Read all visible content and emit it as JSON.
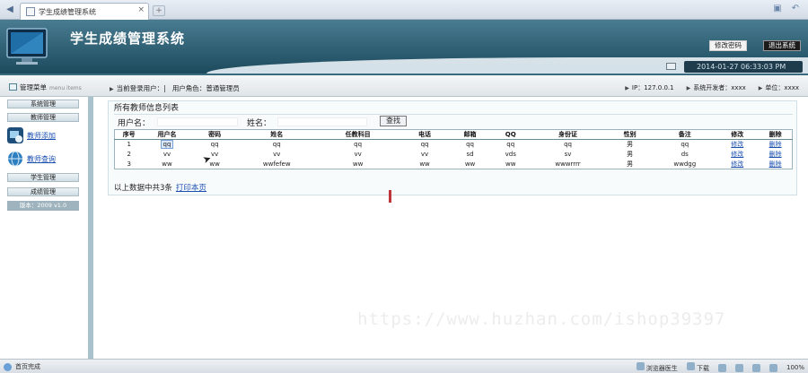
{
  "browser": {
    "tab_title": "学生成绩管理系统",
    "tab_close": "×",
    "new_tab": "+",
    "back_icon": "back-icon",
    "right_icons": [
      "window-icon",
      "undo-icon"
    ]
  },
  "header": {
    "title": "学生成绩管理系统",
    "change_password": "修改密码",
    "logout": "退出系统",
    "datetime": "2014-01-27 06:33:03 PM"
  },
  "infobar": {
    "menu_title": "管理菜单",
    "menu_title_en": "menu items",
    "current_user_label": "当前登录用户：",
    "current_user": "|",
    "role_label": "用户角色：",
    "role": "普通管理员",
    "ip": "IP：127.0.0.1",
    "developer": "系统开发者：xxxx",
    "unit": "单位：xxxx"
  },
  "sidebar": {
    "items": [
      {
        "label": "系统管理",
        "type": "button"
      },
      {
        "label": "教师管理",
        "type": "button"
      },
      {
        "label": "教师添加",
        "type": "link"
      },
      {
        "label": "教师查询",
        "type": "link"
      },
      {
        "label": "学生管理",
        "type": "button"
      },
      {
        "label": "成绩管理",
        "type": "button"
      }
    ],
    "version": "版本：2009 v1.0"
  },
  "main": {
    "panel_title": "所有教师信息列表",
    "search": {
      "username_label": "用户名：",
      "name_label": "姓名：",
      "button": "查找"
    },
    "table": {
      "headers": [
        "序号",
        "用户名",
        "密码",
        "姓名",
        "任教科目",
        "电话",
        "邮箱",
        "QQ",
        "身份证",
        "性别",
        "备注",
        "修改",
        "删除"
      ],
      "rows": [
        [
          "1",
          "qq",
          "qq",
          "qq",
          "qq",
          "qq",
          "qq",
          "qq",
          "qq",
          "男",
          "qq",
          "修改",
          "删除"
        ],
        [
          "2",
          "vv",
          "vv",
          "vv",
          "vv",
          "vv",
          "sd",
          "vds",
          "sv",
          "男",
          "ds",
          "修改",
          "删除"
        ],
        [
          "3",
          "ww",
          "ww",
          "wwfefew",
          "ww",
          "ww",
          "ww",
          "ww",
          "wwwrrrr",
          "男",
          "wwdgg",
          "修改",
          "删除"
        ]
      ]
    },
    "footer_text": "以上数据中共3条",
    "print_link": "打印本页"
  },
  "watermark": "https://www.huzhan.com/ishop39397",
  "statusbar": {
    "left": "首页完成",
    "items": [
      "浏览器医生",
      "下载",
      "100%"
    ]
  },
  "colors": {
    "header_bg": "#2f6074",
    "link": "#1a4fb0",
    "sidebar_border": "#a9c2cc"
  }
}
